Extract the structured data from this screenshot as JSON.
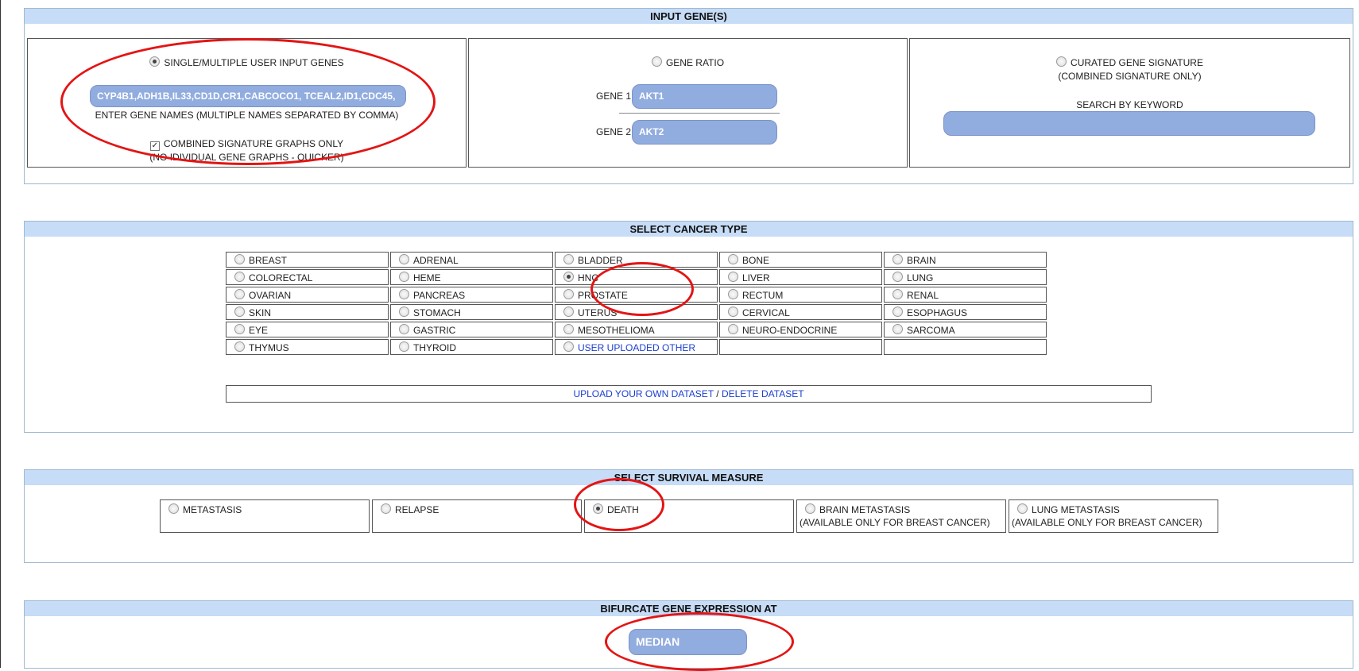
{
  "input_genes": {
    "header": "INPUT GENE(S)",
    "single": {
      "radio_label": "SINGLE/MULTIPLE USER INPUT GENES",
      "gene_value": "CYP4B1,ADH1B,IL33,CD1D,CR1,CABCOCO1, TCEAL2,ID1,CDC45,",
      "help_text": "ENTER GENE NAMES (MULTIPLE NAMES SEPARATED BY COMMA)",
      "combined_label": "COMBINED SIGNATURE GRAPHS ONLY",
      "combined_note": "(NO IDIVIDUAL GENE GRAPHS - QUICKER)",
      "selected": true,
      "combined_checked": true
    },
    "ratio": {
      "radio_label": "GENE RATIO",
      "gene1_label": "GENE 1",
      "gene1_value": "AKT1",
      "gene2_label": "GENE 2",
      "gene2_value": "AKT2"
    },
    "curated": {
      "radio_label": "CURATED GENE SIGNATURE",
      "note": "(COMBINED SIGNATURE ONLY)",
      "search_label": "SEARCH BY KEYWORD",
      "search_value": ""
    }
  },
  "cancer_type": {
    "header": "SELECT CANCER TYPE",
    "rows": [
      [
        "BREAST",
        "ADRENAL",
        "BLADDER",
        "BONE",
        "BRAIN"
      ],
      [
        "COLORECTAL",
        "HEME",
        "HNC",
        "LIVER",
        "LUNG"
      ],
      [
        "OVARIAN",
        "PANCREAS",
        "PROSTATE",
        "RECTUM",
        "RENAL"
      ],
      [
        "SKIN",
        "STOMACH",
        "UTERUS",
        "CERVICAL",
        "ESOPHAGUS"
      ],
      [
        "EYE",
        "GASTRIC",
        "MESOTHELIOMA",
        "NEURO-ENDOCRINE",
        "SARCOMA"
      ],
      [
        "THYMUS",
        "THYROID",
        "USER UPLOADED OTHER",
        "",
        ""
      ]
    ],
    "selected": "HNC",
    "upload_link": "UPLOAD YOUR OWN DATASET",
    "separator": " / ",
    "delete_link": "DELETE DATASET"
  },
  "survival": {
    "header": "SELECT SURVIVAL MEASURE",
    "options": [
      {
        "label": "METASTASIS",
        "note": ""
      },
      {
        "label": "RELAPSE",
        "note": ""
      },
      {
        "label": "DEATH",
        "note": ""
      },
      {
        "label": "BRAIN METASTASIS",
        "note": "(AVAILABLE ONLY FOR BREAST CANCER)"
      },
      {
        "label": "LUNG METASTASIS",
        "note": "(AVAILABLE ONLY FOR BREAST CANCER)"
      }
    ],
    "selected": "DEATH"
  },
  "bifurcate": {
    "header": "BIFURCATE GENE EXPRESSION AT",
    "value": "MEDIAN"
  },
  "colors": {
    "header_bg": "#c6dcf7",
    "input_fill": "#91acdf",
    "annotation": "#e41414",
    "link": "#1a3fcf"
  }
}
